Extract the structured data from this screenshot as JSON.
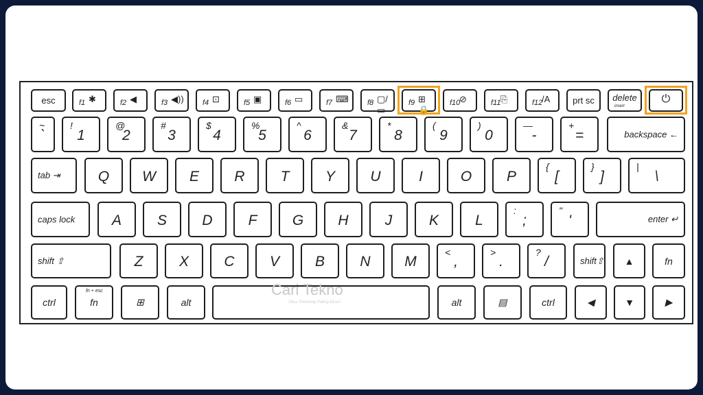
{
  "colors": {
    "frame": "#0e1a3a",
    "highlight": "#f0a320",
    "key_border": "#1e1e1e"
  },
  "watermark": {
    "brand": "Cari Tekno",
    "tagline": "Situs Teknologi Paling Dicari"
  },
  "function_row": [
    {
      "label": "esc"
    },
    {
      "fn": "f1",
      "icon": "✱",
      "icon_name": "keyboard-backlight-off-icon"
    },
    {
      "fn": "f2",
      "icon": "◀",
      "icon_name": "volume-down-icon"
    },
    {
      "fn": "f3",
      "icon": "◀))",
      "icon_name": "volume-up-icon"
    },
    {
      "fn": "f4",
      "icon": "⊡",
      "icon_name": "brightness-down-icon"
    },
    {
      "fn": "f5",
      "icon": "▣",
      "icon_name": "brightness-up-icon"
    },
    {
      "fn": "f6",
      "icon": "▭",
      "icon_name": "touchpad-icon"
    },
    {
      "fn": "f7",
      "icon": "⌨",
      "icon_name": "keyboard-backlight-icon"
    },
    {
      "fn": "f8",
      "icon": "▢/▭",
      "icon_name": "display-switch-icon"
    },
    {
      "fn": "f9",
      "icon": "⊞🔒",
      "icon_name": "windows-lock-icon",
      "highlighted": true
    },
    {
      "fn": "f10",
      "icon": "⊘",
      "icon_name": "camera-off-icon"
    },
    {
      "fn": "f11",
      "icon": "⎘",
      "icon_name": "screenshot-icon"
    },
    {
      "fn": "f12",
      "icon": "/A",
      "icon_name": "myasus-icon"
    },
    {
      "label": "prt sc"
    },
    {
      "label": "delete",
      "sub": "insert"
    },
    {
      "icon": "⏻",
      "icon_name": "power-icon",
      "highlighted": true
    }
  ],
  "rows": [
    [
      {
        "m": "`",
        "s": "~"
      },
      {
        "m": "1",
        "s": "!"
      },
      {
        "m": "2",
        "s": "@"
      },
      {
        "m": "3",
        "s": "#"
      },
      {
        "m": "4",
        "s": "$"
      },
      {
        "m": "5",
        "s": "%"
      },
      {
        "m": "6",
        "s": "^"
      },
      {
        "m": "7",
        "s": "&"
      },
      {
        "m": "8",
        "s": "*"
      },
      {
        "m": "9",
        "s": "("
      },
      {
        "m": "0",
        "s": ")"
      },
      {
        "m": "-",
        "s": "—"
      },
      {
        "m": "=",
        "s": "+"
      },
      {
        "w": "backspace ←"
      }
    ],
    [
      {
        "w": "tab ⇥"
      },
      {
        "m": "Q"
      },
      {
        "m": "W"
      },
      {
        "m": "E"
      },
      {
        "m": "R"
      },
      {
        "m": "T"
      },
      {
        "m": "Y"
      },
      {
        "m": "U"
      },
      {
        "m": "I"
      },
      {
        "m": "O"
      },
      {
        "m": "P"
      },
      {
        "m": "[",
        "s": "{"
      },
      {
        "m": "]",
        "s": "}"
      },
      {
        "m": "\\",
        "s": "|"
      }
    ],
    [
      {
        "w": "caps lock"
      },
      {
        "m": "A"
      },
      {
        "m": "S"
      },
      {
        "m": "D"
      },
      {
        "m": "F"
      },
      {
        "m": "G"
      },
      {
        "m": "H"
      },
      {
        "m": "J"
      },
      {
        "m": "K"
      },
      {
        "m": "L"
      },
      {
        "m": ";",
        "s": ":"
      },
      {
        "m": "'",
        "s": "\""
      },
      {
        "w": "enter ↵"
      }
    ],
    [
      {
        "w": "shift ⇧"
      },
      {
        "m": "Z"
      },
      {
        "m": "X"
      },
      {
        "m": "C"
      },
      {
        "m": "V"
      },
      {
        "m": "B"
      },
      {
        "m": "N"
      },
      {
        "m": "M"
      },
      {
        "m": ",",
        "s": "<"
      },
      {
        "m": ".",
        "s": ">"
      },
      {
        "m": "/",
        "s": "?"
      },
      {
        "w": "shift⇧"
      },
      {
        "c": "▲"
      },
      {
        "c": "fn"
      }
    ],
    [
      {
        "c": "ctrl"
      },
      {
        "c": "fn",
        "sub": "fn + esc"
      },
      {
        "c": "⊞",
        "icon_name": "windows-icon"
      },
      {
        "c": "alt"
      },
      {
        "c": ""
      },
      {
        "c": "alt"
      },
      {
        "c": "▤",
        "icon_name": "menu-icon"
      },
      {
        "c": "ctrl"
      },
      {
        "c": "◀"
      },
      {
        "c": "▼"
      },
      {
        "c": "▶"
      }
    ]
  ]
}
